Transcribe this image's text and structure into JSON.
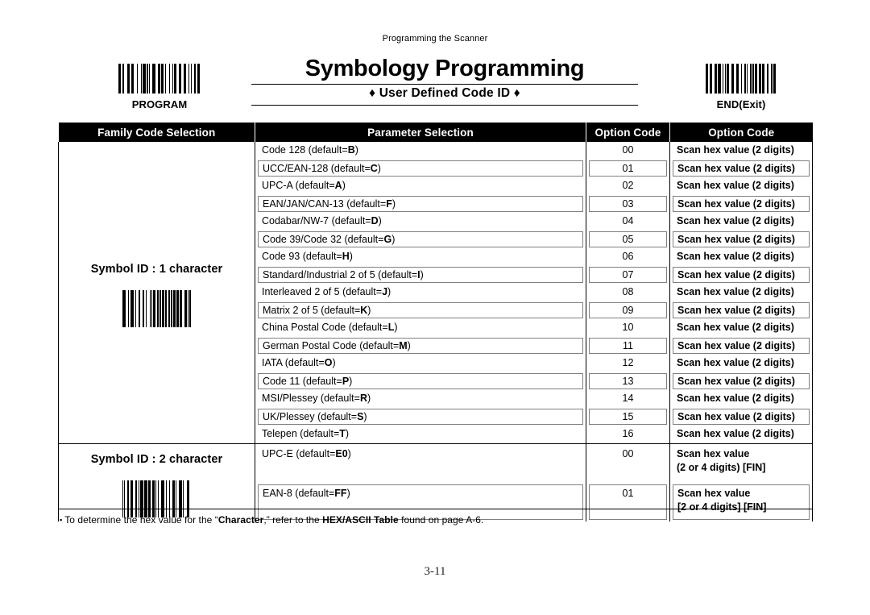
{
  "running_head": "Programming the Scanner",
  "title": "Symbology Programming",
  "subtitle": "♦ User Defined Code ID ♦",
  "program_barcode": {
    "label": "PROGRAM",
    "icon": "barcode-icon"
  },
  "end_barcode": {
    "label": "END(Exit)",
    "icon": "barcode-icon"
  },
  "table": {
    "headers": [
      "Family Code Selection",
      "Parameter Selection",
      "Option Code",
      "Option Code"
    ],
    "sections": [
      {
        "family_title": "Symbol ID : 1 character",
        "family_barcode": "barcode-icon",
        "rows": [
          {
            "parameter": "Code 128 (default=B)",
            "param_bold": "B",
            "option": "00",
            "action": "Scan hex value (2 digits)",
            "boxed": false
          },
          {
            "parameter": "UCC/EAN-128 (default=C)",
            "param_bold": "C",
            "option": "01",
            "action": "Scan hex value (2 digits)",
            "boxed": true
          },
          {
            "parameter": "UPC-A (default=A)",
            "param_bold": "A",
            "option": "02",
            "action": "Scan hex value (2 digits)",
            "boxed": false
          },
          {
            "parameter": "EAN/JAN/CAN-13 (default=F)",
            "param_bold": "F",
            "option": "03",
            "action": "Scan hex value (2 digits)",
            "boxed": true
          },
          {
            "parameter": "Codabar/NW-7 (default=D)",
            "param_bold": "D",
            "option": "04",
            "action": "Scan hex value (2 digits)",
            "boxed": false
          },
          {
            "parameter": "Code 39/Code 32 (default=G)",
            "param_bold": "G",
            "option": "05",
            "action": "Scan hex value (2 digits)",
            "boxed": true
          },
          {
            "parameter": "Code 93 (default=H)",
            "param_bold": "H",
            "option": "06",
            "action": "Scan hex value (2 digits)",
            "boxed": false
          },
          {
            "parameter": "Standard/Industrial 2 of 5 (default=I)",
            "param_bold": "I",
            "option": "07",
            "action": "Scan hex value (2 digits)",
            "boxed": true
          },
          {
            "parameter": "Interleaved 2 of 5 (default=J)",
            "param_bold": "J",
            "option": "08",
            "action": "Scan hex value (2 digits)",
            "boxed": false
          },
          {
            "parameter": "Matrix 2 of 5 (default=K)",
            "param_bold": "K",
            "option": "09",
            "action": "Scan hex value (2 digits)",
            "boxed": true
          },
          {
            "parameter": "China Postal Code (default=L)",
            "param_bold": "L",
            "option": "10",
            "action": "Scan hex value (2 digits)",
            "boxed": false
          },
          {
            "parameter": "German Postal Code (default=M)",
            "param_bold": "M",
            "option": "11",
            "action": "Scan hex value (2 digits)",
            "boxed": true
          },
          {
            "parameter": "IATA (default=O)",
            "param_bold": "O",
            "option": "12",
            "action": "Scan hex value (2 digits)",
            "boxed": false
          },
          {
            "parameter": "Code 11 (default=P)",
            "param_bold": "P",
            "option": "13",
            "action": "Scan hex value (2 digits)",
            "boxed": true
          },
          {
            "parameter": "MSI/Plessey (default=R)",
            "param_bold": "R",
            "option": "14",
            "action": "Scan hex value (2 digits)",
            "boxed": false
          },
          {
            "parameter": "UK/Plessey (default=S)",
            "param_bold": "S",
            "option": "15",
            "action": "Scan hex value (2 digits)",
            "boxed": true
          },
          {
            "parameter": "Telepen (default=T)",
            "param_bold": "T",
            "option": "16",
            "action": "Scan hex value (2 digits)",
            "boxed": false
          }
        ]
      },
      {
        "family_title": "Symbol ID : 2 character",
        "family_barcode": "barcode-icon",
        "rows": [
          {
            "parameter": "UPC-E (default=E0)",
            "param_bold": "E0",
            "option": "00",
            "action_line1": "Scan hex value",
            "action_line2": "(2 or 4 digits) [FIN]",
            "boxed": false
          },
          {
            "parameter": "EAN-8 (default=FF)",
            "param_bold": "FF",
            "option": "01",
            "action_line1": "Scan hex value",
            "action_line2": "[2 or 4 digits] [FIN]",
            "boxed": true
          }
        ]
      }
    ]
  },
  "footnote": {
    "bullet": "▪",
    "part1": "To determine the hex value for the “",
    "bold1": "Character",
    "part2": ",” refer to the ",
    "bold2": "HEX/ASCII Table",
    "part3": " found on page A-6."
  },
  "page_number": "3-11"
}
